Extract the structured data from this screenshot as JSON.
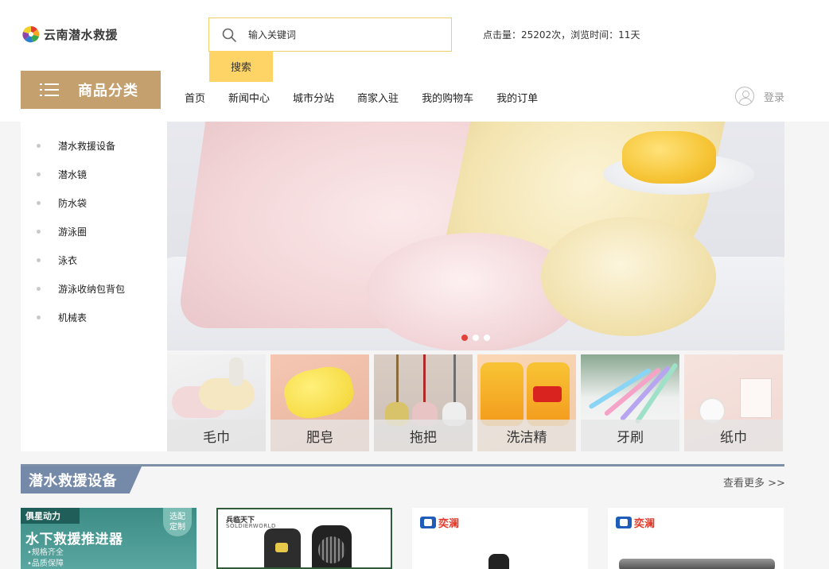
{
  "header": {
    "logo_text": "云南潜水救援",
    "search": {
      "placeholder": "输入关键词",
      "button_label": "搜索"
    },
    "stats_text": "点击量：25202次，浏览时间：11天"
  },
  "category": {
    "title": "商品分类"
  },
  "nav": {
    "items": [
      "首页",
      "新闻中心",
      "城市分站",
      "商家入驻",
      "我的购物车",
      "我的订单"
    ],
    "login_label": "登录"
  },
  "sidebar": {
    "items": [
      "潜水救援设备",
      "潜水镜",
      "防水袋",
      "游泳圈",
      "泳衣",
      "游泳收纳包背包",
      "机械表"
    ]
  },
  "banner": {
    "slides": 3,
    "active_slide": 1
  },
  "tiles": [
    "毛巾",
    "肥皂",
    "拖把",
    "洗洁精",
    "牙刷",
    "纸巾"
  ],
  "section": {
    "title": "潜水救援设备",
    "more_label": "查看更多 >>",
    "products": [
      {
        "badge": "俱星动力",
        "tag": "选配定制",
        "title": "水下救援推进器",
        "sub1": "•规格齐全",
        "sub2": "•品质保障"
      },
      {
        "brand": "兵临天下",
        "brand_en": "SOLDIERWORLD"
      },
      {
        "brand": "奕澜"
      },
      {
        "brand": "奕澜"
      }
    ]
  },
  "colors": {
    "accent": "#ffd466",
    "category": "#c4a06f",
    "section": "#7589a8",
    "dot_active": "#e0443a"
  },
  "icons": [
    "logo-pinwheel-icon",
    "search-icon",
    "menu-icon",
    "user-icon"
  ]
}
